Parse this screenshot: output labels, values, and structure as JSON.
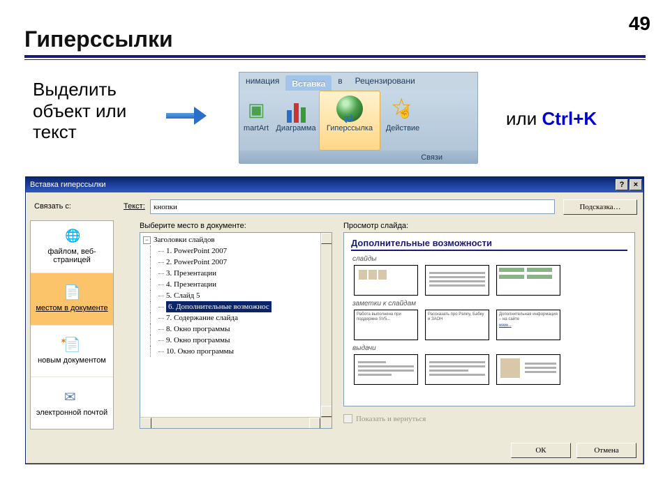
{
  "page": {
    "number": "49",
    "title": "Гиперссылки"
  },
  "hint": "Выделить объект или текст",
  "ribbon": {
    "tabs": [
      "нимация",
      "Вставка",
      "в",
      "Рецензировани"
    ],
    "active_index": 1,
    "buttons": {
      "smartart": "martArt",
      "chart": "Диаграмма",
      "hyperlink": "Гиперссылка",
      "action": "Действие"
    },
    "group": "Связи"
  },
  "hotkey": {
    "prefix": "или ",
    "combo": "Ctrl+K"
  },
  "dialog": {
    "title": "Вставка гиперссылки",
    "link_with_label": "Связать с:",
    "text_label": "Текст:",
    "text_value": "кнопки",
    "screentip_btn": "Подсказка…",
    "places_label": "Выберите место в документе:",
    "preview_label": "Просмотр слайда:",
    "show_return": "Показать и вернуться",
    "ok": "ОК",
    "cancel": "Отмена",
    "options": {
      "web": "файлом, веб-страницей",
      "place": "местом в документе",
      "new": "новым документом",
      "mail": "электронной почтой"
    },
    "tree": {
      "root": "Заголовки слайдов",
      "items": [
        "1. PowerPoint 2007",
        "2. PowerPoint 2007",
        "3. Презентации",
        "4. Презентации",
        "5. Слайд 5",
        "6. Дополнительные возможнос",
        "7. Содержание слайда",
        "8. Окно программы",
        "9. Окно программы",
        "10. Окно программы"
      ],
      "selected_index": 5
    },
    "preview": {
      "title": "Дополнительные возможности",
      "sections": [
        "слайды",
        "заметки к слайдам",
        "выдачи"
      ],
      "note1": "Работа выполнена при поддержке SV5...",
      "note2": "Рассказать про Panny, Бабку и ЗАОН",
      "note3": "Дополнительная информация – на сайте"
    }
  }
}
